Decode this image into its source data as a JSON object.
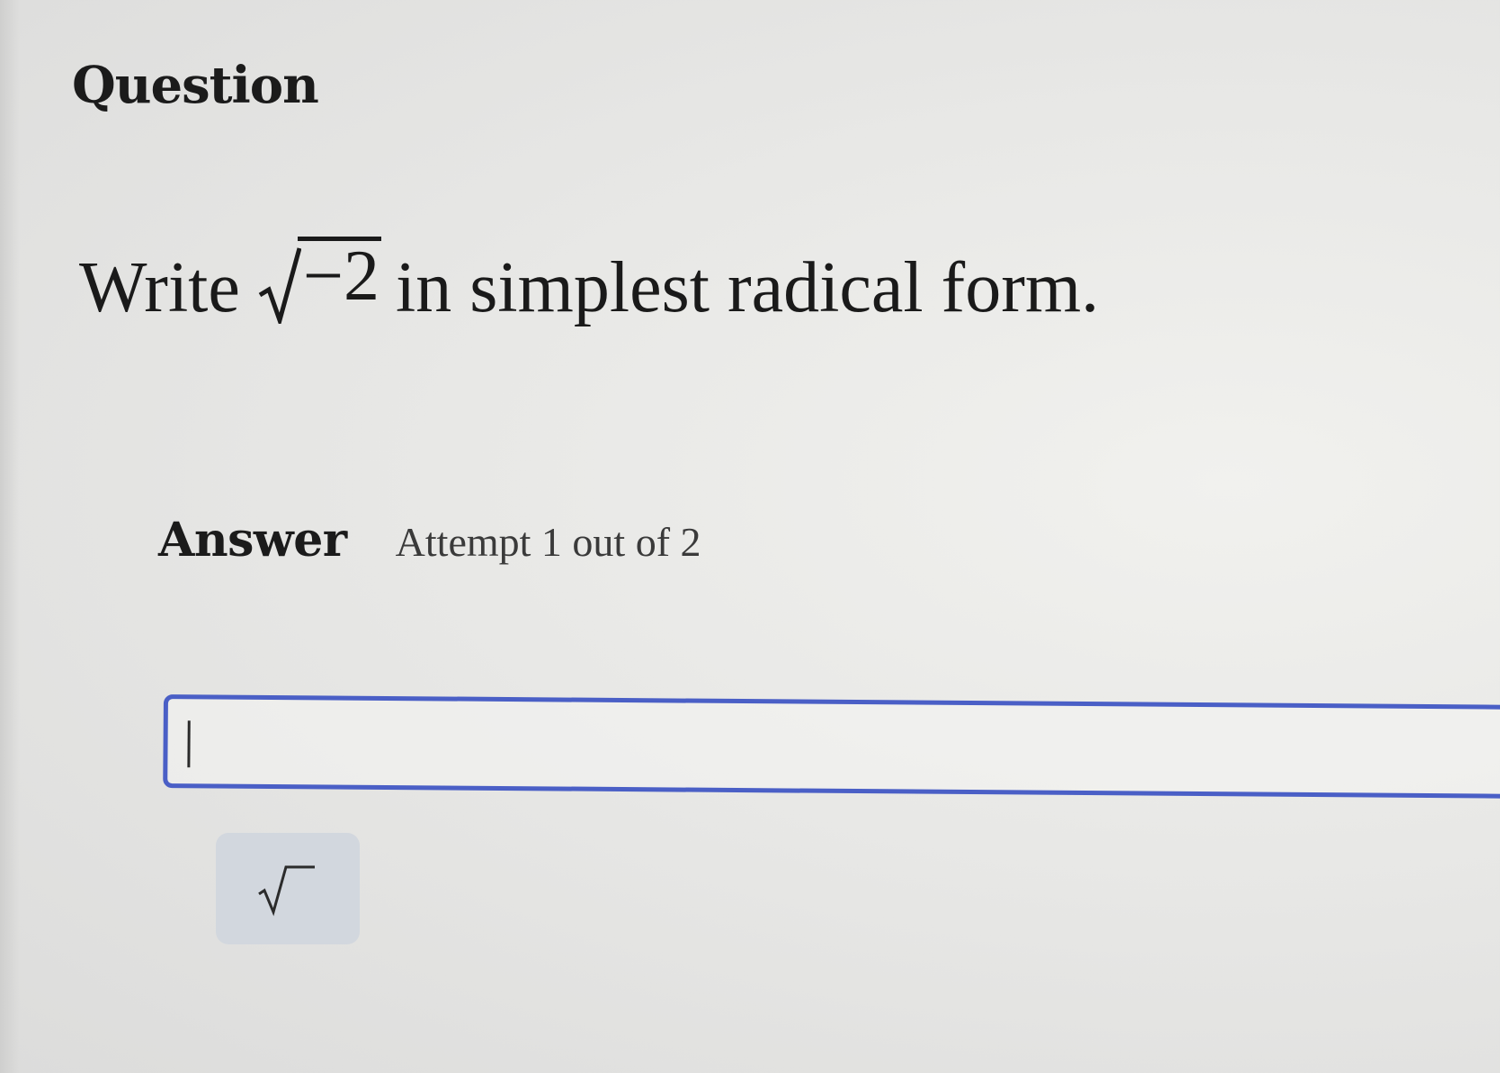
{
  "heading": "Question",
  "question": {
    "prefix": "Write",
    "radicand": "−2",
    "suffix": "in simplest radical form."
  },
  "answer": {
    "label": "Answer",
    "attempt": "Attempt 1 out of 2"
  },
  "input": {
    "value": ""
  },
  "colors": {
    "input_border": "#4a5fc6",
    "button_bg": "#d2d7de"
  },
  "toolbar": {
    "buttons": [
      {
        "icon": "square-root-icon"
      }
    ]
  }
}
